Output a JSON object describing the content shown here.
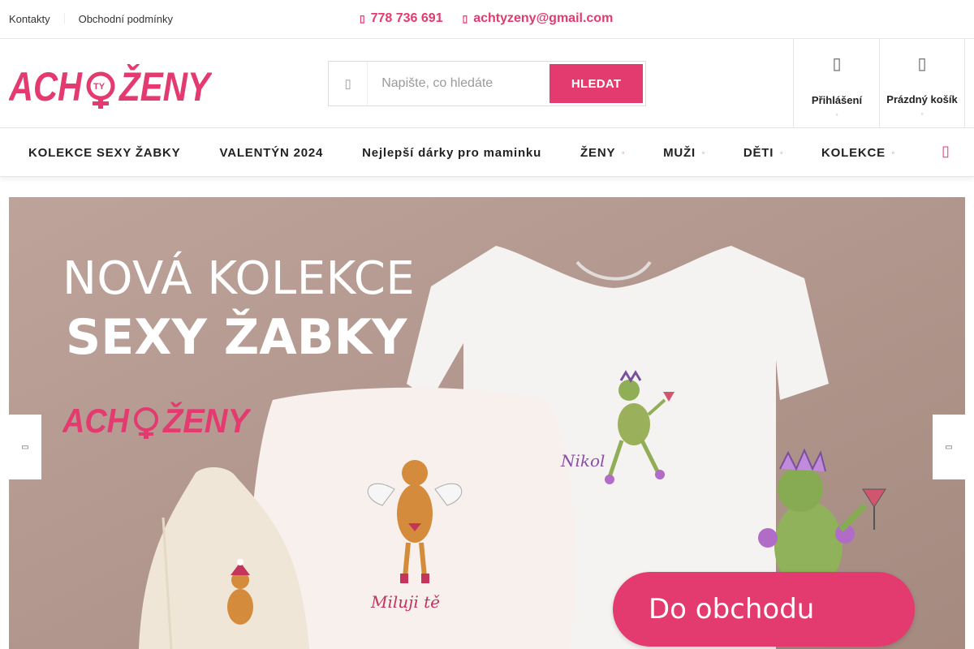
{
  "topbar": {
    "links": [
      "Kontakty",
      "Obchodní podmínky"
    ],
    "phone": "778 736 691",
    "email": "achtyzeny@gmail.com",
    "phone_icon": "phone-icon",
    "email_icon": "envelope-icon"
  },
  "brand": {
    "logo_text": "ACHTYŽENY",
    "accent_color": "#e33a6f"
  },
  "search": {
    "placeholder": "Napište, co hledáte",
    "value": "",
    "button_label": "HLEDAT"
  },
  "account": {
    "login_label": "Přihlášení",
    "cart_label": "Prázdný košík"
  },
  "nav": {
    "items": [
      {
        "label": "KOLEKCE SEXY ŽABKY",
        "has_dropdown": false
      },
      {
        "label": "VALENTÝN 2024",
        "has_dropdown": false
      },
      {
        "label": "Nejlepší dárky pro maminku",
        "has_dropdown": false
      },
      {
        "label": "ŽENY",
        "has_dropdown": true
      },
      {
        "label": "MUŽI",
        "has_dropdown": true
      },
      {
        "label": "DĚTI",
        "has_dropdown": true
      },
      {
        "label": "KOLEKCE",
        "has_dropdown": true
      }
    ]
  },
  "banner": {
    "line1": "NOVÁ KOLEKCE",
    "line2": "SEXY ŽABKY",
    "shirt_text": "Nikol",
    "pillow_text": "Miluji tě",
    "cta_label": "Do obchodu"
  }
}
